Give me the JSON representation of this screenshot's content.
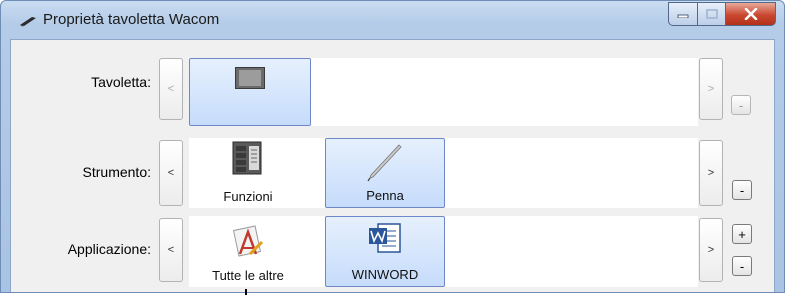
{
  "window": {
    "title": "Proprietà tavoletta Wacom",
    "controls": {
      "minimize": "–",
      "maximize": "□",
      "close": "X"
    }
  },
  "rows": {
    "tablet": {
      "label": "Tavoletta:",
      "prev": "<",
      "next": ">",
      "remove": "-"
    },
    "tool": {
      "label": "Strumento:",
      "prev": "<",
      "next": ">",
      "remove": "-",
      "items": [
        {
          "label": "Funzioni",
          "icon": "functions-icon"
        },
        {
          "label": "Penna",
          "icon": "pen-icon"
        }
      ]
    },
    "application": {
      "label": "Applicazione:",
      "prev": "<",
      "next": ">",
      "add": "+",
      "remove": "-",
      "items": [
        {
          "label": "Tutte le altre",
          "icon": "all-apps-icon"
        },
        {
          "label": "WINWORD",
          "icon": "word-icon"
        }
      ]
    }
  }
}
